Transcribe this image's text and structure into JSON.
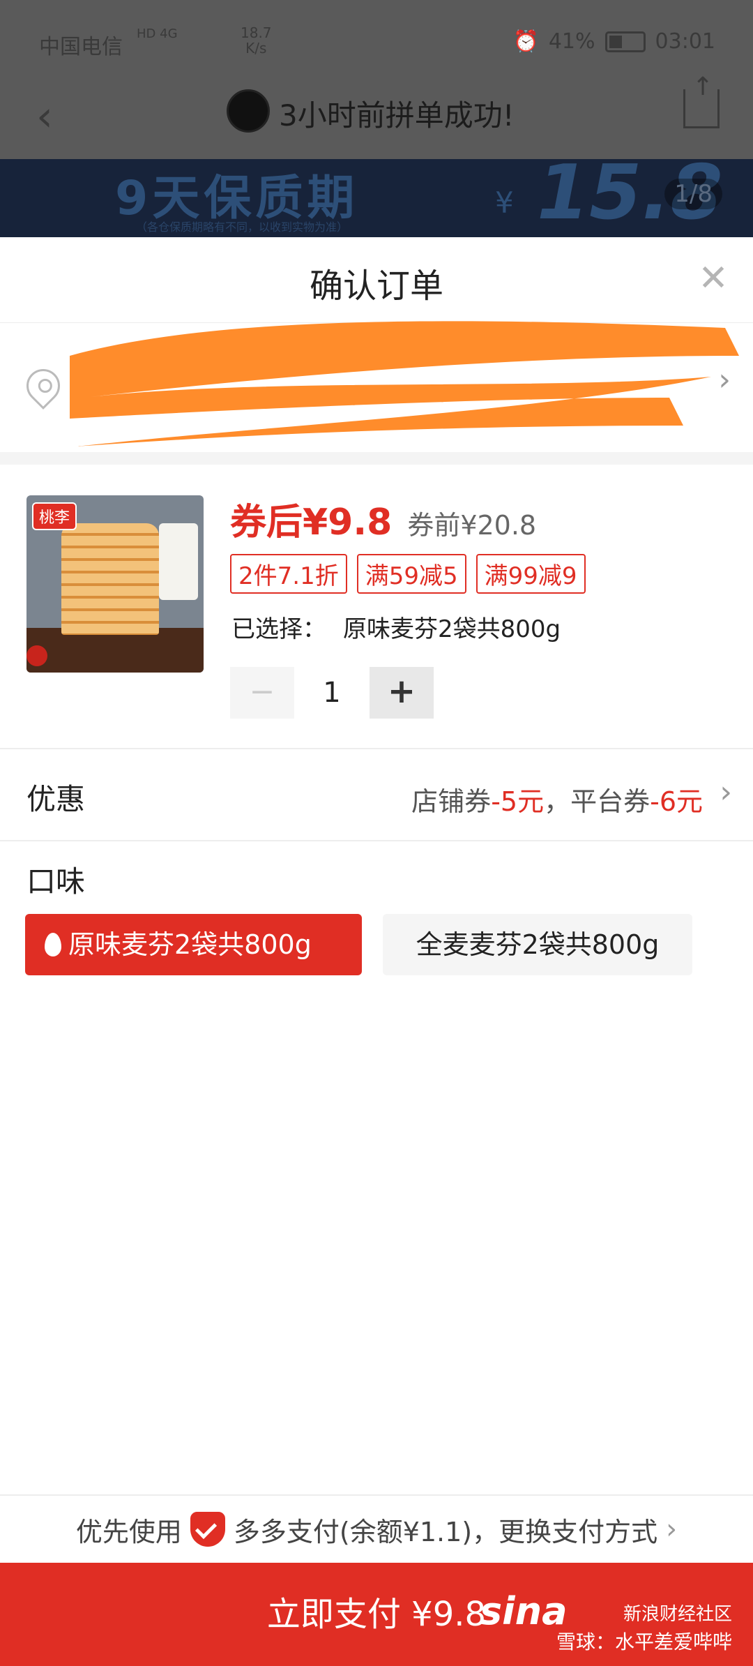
{
  "status": {
    "carrier": "中国电信",
    "network": "HD 4G",
    "speed": "18.7\nK/s",
    "battery": "41%",
    "time": "03:01"
  },
  "nav": {
    "title": "3小时前拼单成功!"
  },
  "banner": {
    "headline": "9天保质期",
    "note": "（各仓保质期略有不同，以收到实物为准）",
    "currency": "¥",
    "price": "15.8",
    "counter": "1/8"
  },
  "sheet": {
    "title": "确认订单",
    "close": "✕"
  },
  "address": {
    "line1": "",
    "line2": ""
  },
  "product": {
    "image_tag": "桃李",
    "price_after": "券后¥9.8",
    "price_before": "券前¥20.8",
    "promos": [
      "2件7.1折",
      "满59减5",
      "满99减9"
    ],
    "selected_label": "已选择：",
    "selected_value": "原味麦芬2袋共800g",
    "quantity": "1",
    "minus": "−",
    "plus": "+"
  },
  "discount": {
    "label": "优惠",
    "shop_coupon": "店铺券",
    "shop_amount": "-5元",
    "separator": "，",
    "platform_coupon": "平台券",
    "platform_amount": "-6元"
  },
  "flavor": {
    "label": "口味",
    "options": [
      "原味麦芬2袋共800g",
      "全麦麦芬2袋共800g"
    ],
    "selected_index": 0
  },
  "payment": {
    "prefix": "优先使用",
    "method": "多多支付(余额¥1.1)，更换支付方式"
  },
  "pay_button": {
    "label": "立即支付 ¥9.8"
  },
  "watermark": {
    "logo": "sina",
    "line1": "新浪财经社区",
    "line2": "雪球：水平差爱哔哔"
  },
  "colors": {
    "accent": "#e02e24",
    "scribble": "#ff8c2b",
    "dim": "#5a5a5a"
  }
}
